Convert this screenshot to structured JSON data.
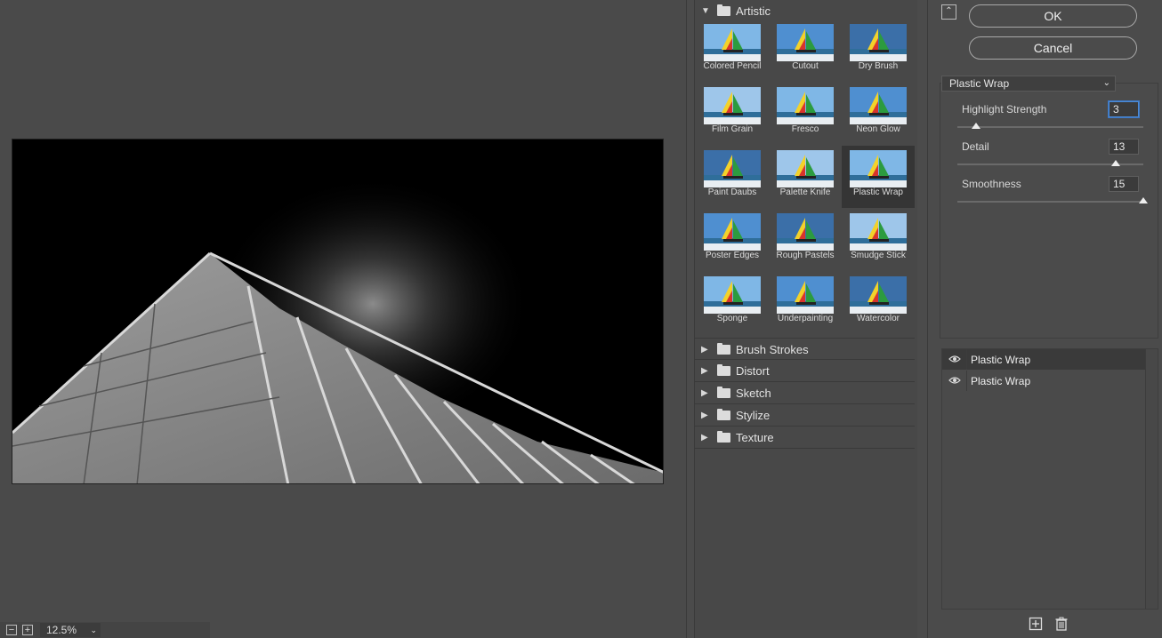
{
  "preview": {
    "zoom_out_label": "−",
    "zoom_in_label": "+",
    "zoom_value": "12.5%"
  },
  "gallery": {
    "open_folder": "Artistic",
    "filters": [
      {
        "label": "Colored Pencil"
      },
      {
        "label": "Cutout"
      },
      {
        "label": "Dry Brush"
      },
      {
        "label": "Film Grain"
      },
      {
        "label": "Fresco"
      },
      {
        "label": "Neon Glow"
      },
      {
        "label": "Paint Daubs"
      },
      {
        "label": "Palette Knife"
      },
      {
        "label": "Plastic Wrap"
      },
      {
        "label": "Poster Edges"
      },
      {
        "label": "Rough Pastels"
      },
      {
        "label": "Smudge Stick"
      },
      {
        "label": "Sponge"
      },
      {
        "label": "Underpainting"
      },
      {
        "label": "Watercolor"
      }
    ],
    "selected_filter": "Plastic Wrap",
    "folders": [
      "Brush Strokes",
      "Distort",
      "Sketch",
      "Stylize",
      "Texture"
    ]
  },
  "controls": {
    "ok_label": "OK",
    "cancel_label": "Cancel",
    "filter_select": "Plastic Wrap",
    "params": [
      {
        "label": "Highlight Strength",
        "value": "3",
        "level": 0.1
      },
      {
        "label": "Detail",
        "value": "13",
        "level": 0.85
      },
      {
        "label": "Smoothness",
        "value": "15",
        "level": 1.0
      }
    ]
  },
  "layers": [
    {
      "name": "Plastic Wrap",
      "active": true
    },
    {
      "name": "Plastic Wrap",
      "active": false
    }
  ],
  "colors": {
    "background": "#4b4b4b",
    "focus_ring": "#4c8ad6",
    "selected_thumb": "#353535"
  },
  "icons": [
    "zoom-out-icon",
    "zoom-in-icon",
    "chevron-down-icon",
    "folder-icon",
    "disclosure-triangle-icon",
    "collapse-panel-icon",
    "eye-icon",
    "new-layer-icon",
    "trash-icon"
  ]
}
